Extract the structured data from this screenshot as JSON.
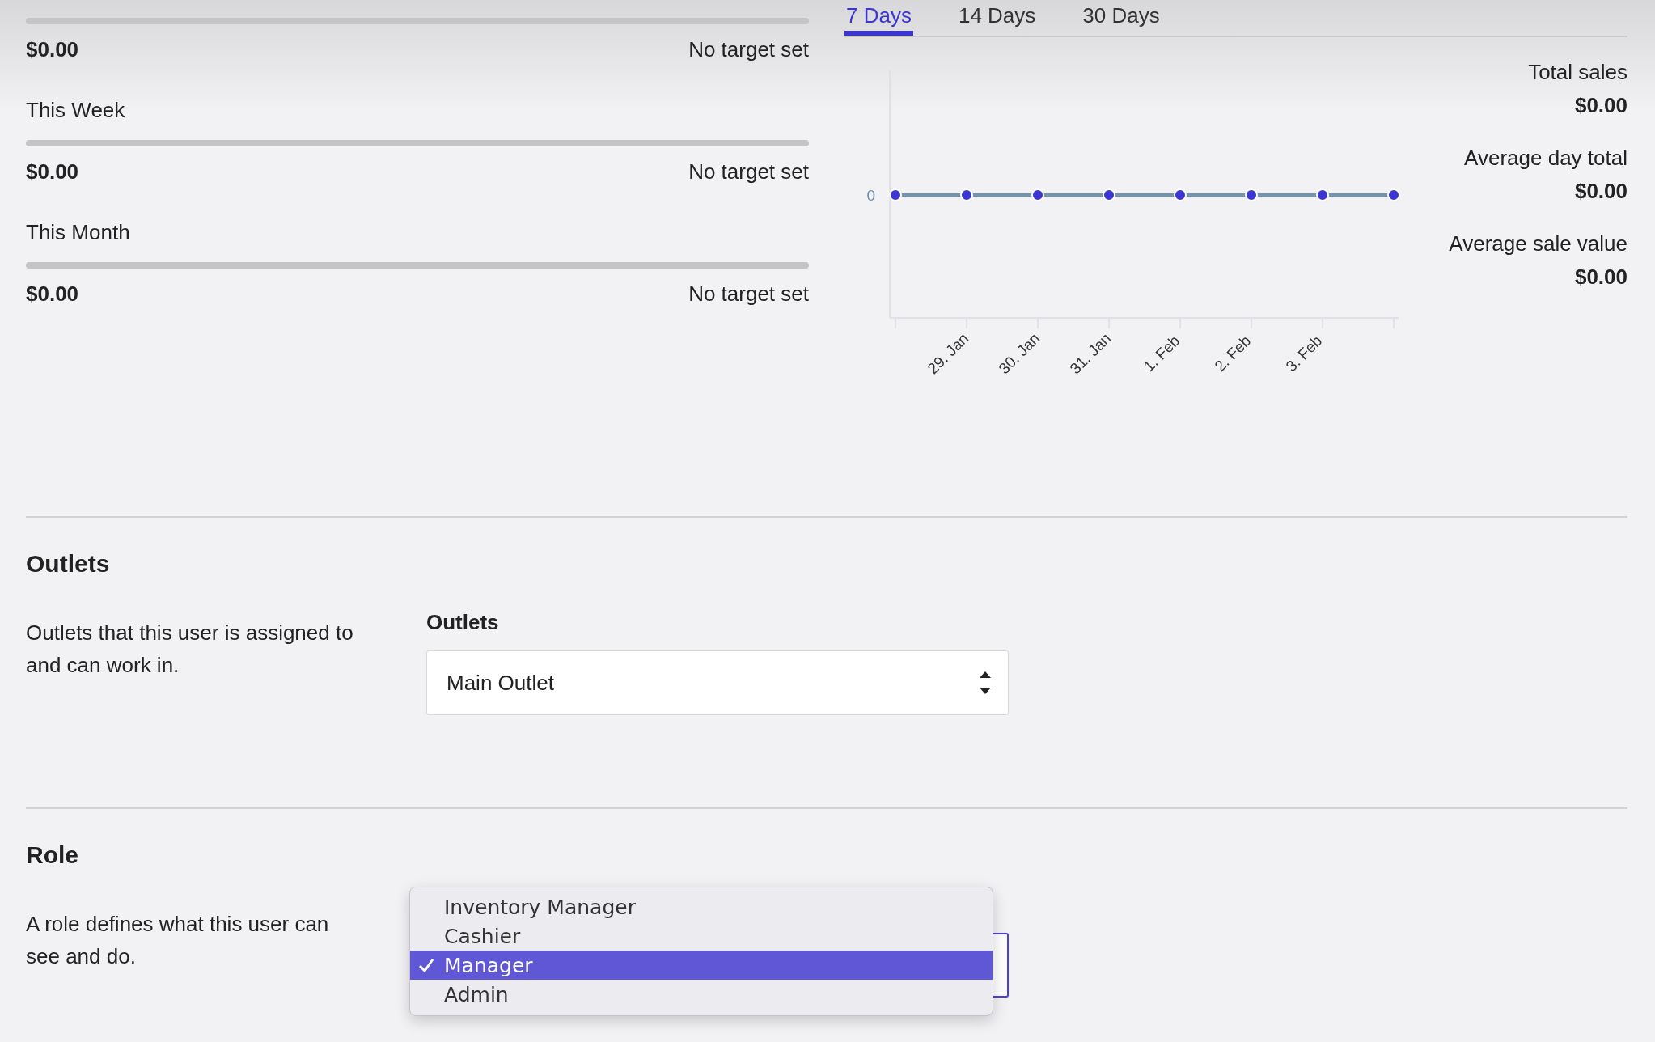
{
  "targets": [
    {
      "level": 0,
      "amount": "$0.00",
      "target": "No target set"
    },
    {
      "label": "This Week",
      "level": 0,
      "amount": "$0.00",
      "target": "No target set"
    },
    {
      "label": "This Month",
      "level": 0,
      "amount": "$0.00",
      "target": "No target set"
    }
  ],
  "tabs": [
    {
      "label": "7 Days",
      "selected": true
    },
    {
      "label": "14 Days",
      "selected": false
    },
    {
      "label": "30 Days",
      "selected": false
    }
  ],
  "chart": {
    "zero_label": "0",
    "x_labels": [
      "29. Jan",
      "30. Jan",
      "31. Jan",
      "1. Feb",
      "2. Feb",
      "3. Feb"
    ]
  },
  "stats": [
    {
      "label": "Total sales",
      "value": "$0.00"
    },
    {
      "label": "Average day total",
      "value": "$0.00"
    },
    {
      "label": "Average sale value",
      "value": "$0.00"
    }
  ],
  "sections": [
    {
      "title": "Outlets",
      "description": "Outlets that this user is assigned to and can work in.",
      "field_label": "Outlets",
      "select": {
        "value": "Main Outlet",
        "focused": false
      }
    },
    {
      "title": "Role",
      "description": "A role defines what this user can see and do.",
      "select": {
        "focused": true,
        "options": [
          {
            "label": "Inventory Manager",
            "selected": false
          },
          {
            "label": "Cashier",
            "selected": false
          },
          {
            "label": "Manager",
            "selected": true
          },
          {
            "label": "Admin",
            "selected": false
          }
        ]
      }
    }
  ]
}
